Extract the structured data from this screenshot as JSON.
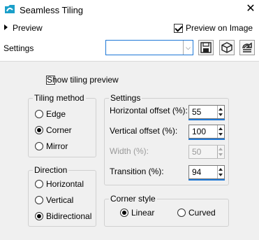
{
  "window": {
    "title": "Seamless Tiling"
  },
  "preview_toggle": {
    "label": "Preview"
  },
  "preview_on_image": {
    "label": "Preview on Image",
    "checked": true
  },
  "settings_bar": {
    "label": "Settings",
    "preset_value": ""
  },
  "show_tiling_preview": {
    "label": "Show tiling preview",
    "checked": false
  },
  "tiling_method": {
    "title": "Tiling method",
    "options": [
      {
        "label": "Edge",
        "selected": false
      },
      {
        "label": "Corner",
        "selected": true
      },
      {
        "label": "Mirror",
        "selected": false
      }
    ]
  },
  "direction": {
    "title": "Direction",
    "options": [
      {
        "label": "Horizontal",
        "selected": false
      },
      {
        "label": "Vertical",
        "selected": false
      },
      {
        "label": "Bidirectional",
        "selected": true
      }
    ]
  },
  "settings": {
    "title": "Settings",
    "horizontal_offset": {
      "label": "Horizontal offset (%):",
      "value": "55"
    },
    "vertical_offset": {
      "label": "Vertical offset (%):",
      "value": "100"
    },
    "width": {
      "label": "Width (%):",
      "value": "50",
      "enabled": false
    },
    "transition": {
      "label": "Transition (%):",
      "value": "94"
    }
  },
  "corner_style": {
    "title": "Corner style",
    "options": [
      {
        "label": "Linear",
        "selected": true
      },
      {
        "label": "Curved",
        "selected": false
      }
    ]
  },
  "colors": {
    "accent": "#1e78d6",
    "app_icon": "#1b9fc9",
    "panel_bg": "#f0f0f0"
  },
  "icons": [
    "app-icon",
    "close-icon",
    "chevron-right-icon",
    "chevron-down-icon",
    "save-icon",
    "cube-icon",
    "reset-icon"
  ]
}
